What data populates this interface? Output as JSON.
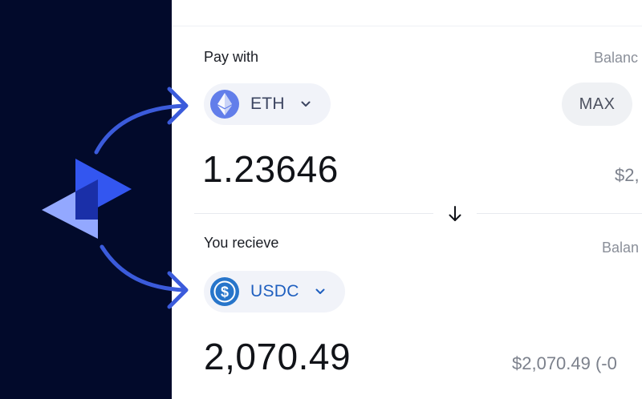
{
  "pay": {
    "label": "Pay with",
    "balance_label": "Balanc",
    "token": {
      "symbol": "ETH",
      "icon": "ethereum-icon",
      "color": "#627eea"
    },
    "max_label": "MAX",
    "amount": "1.23646",
    "usd_value": "$2,"
  },
  "receive": {
    "label": "You recieve",
    "balance_label": "Balan",
    "token": {
      "symbol": "USDC",
      "icon": "usdc-icon",
      "color": "#2775ca"
    },
    "amount": "2,070.49",
    "usd_value": "$2,070.49 (-0"
  },
  "swap_direction_icon": "arrow-down-icon",
  "colors": {
    "background_dark": "#020a2b",
    "accent_arrow": "#3b5bdb",
    "eth_text": "#3b4460",
    "usdc_text": "#1f5fbf",
    "logo_light": "#93a8ff",
    "logo_main": "#3356f0",
    "logo_overlap": "#1a2fa8"
  }
}
